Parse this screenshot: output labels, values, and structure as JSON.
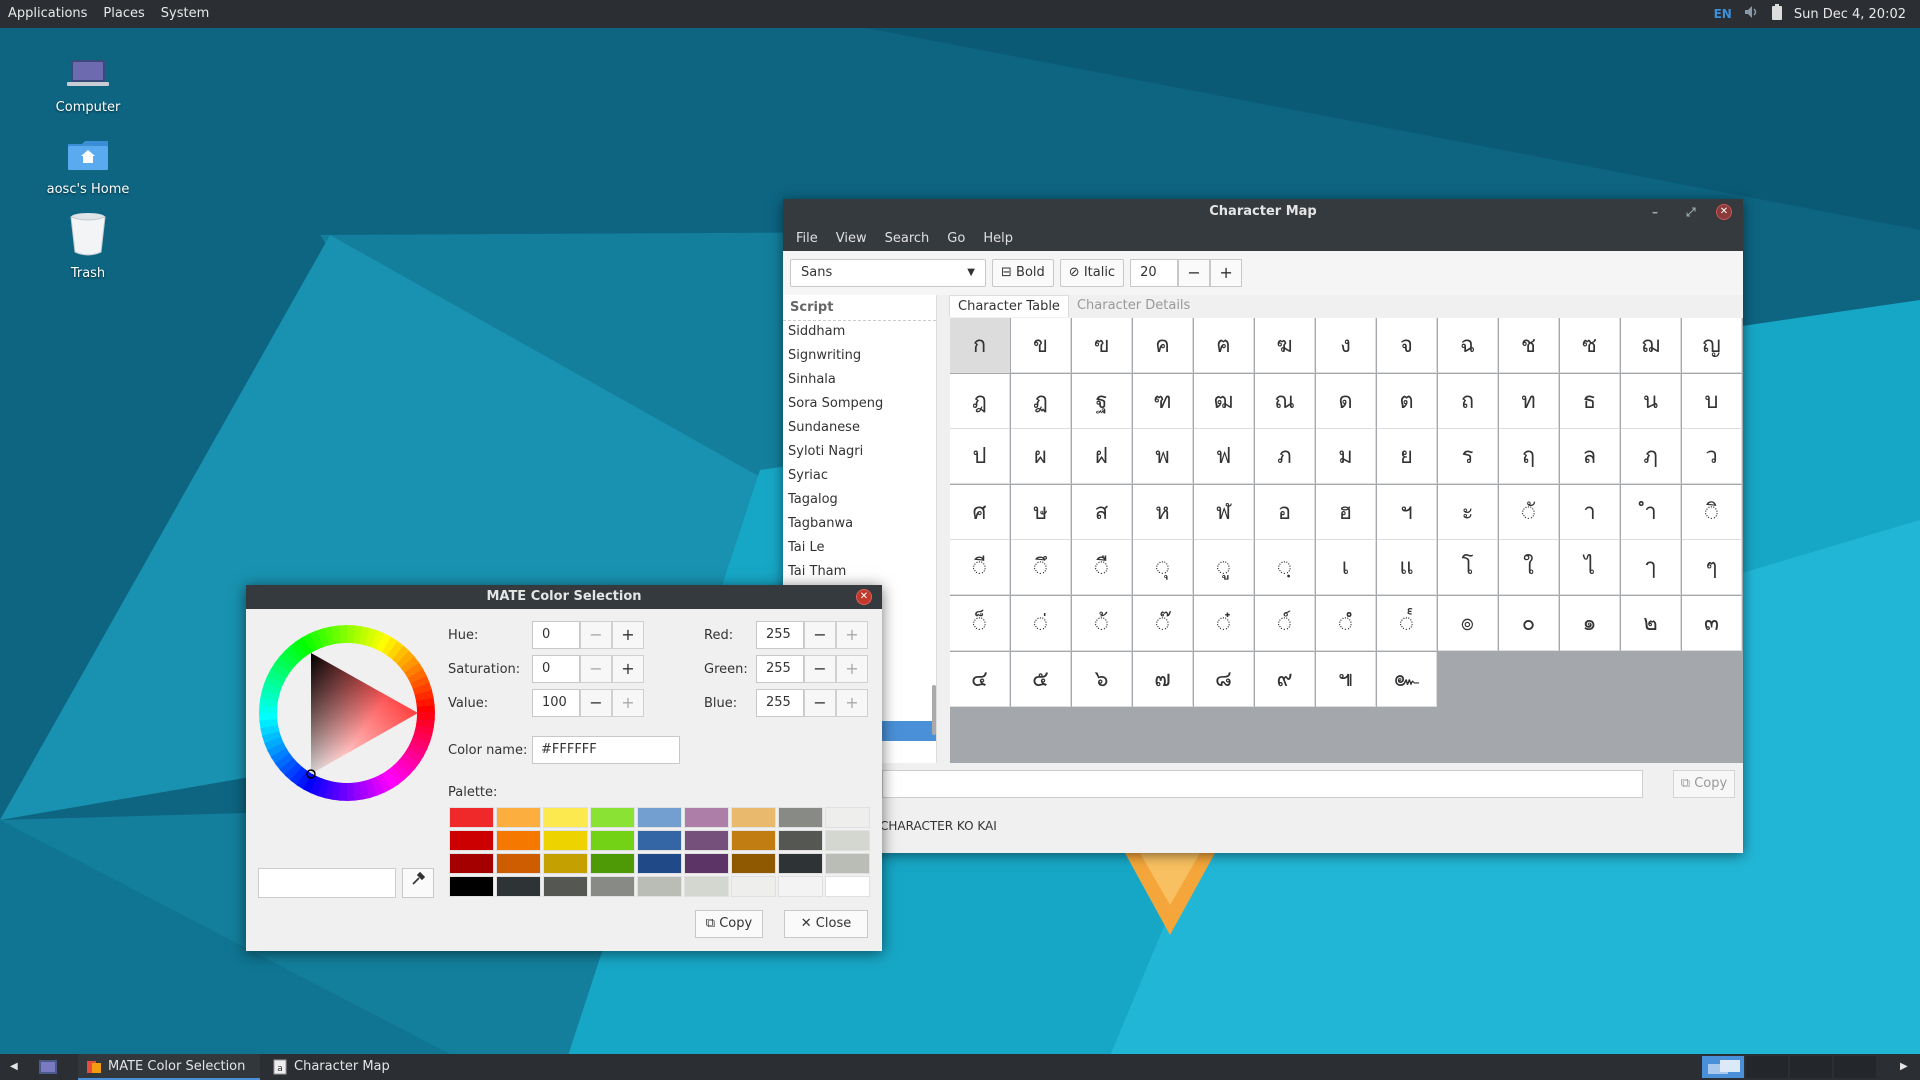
{
  "top_panel": {
    "menus": [
      "Applications",
      "Places",
      "System"
    ],
    "keyboard": "EN",
    "clock": "Sun Dec 4, 20:02"
  },
  "desktop": {
    "icons": [
      {
        "label": "Computer",
        "icon": "laptop-icon"
      },
      {
        "label": "aosc's Home",
        "icon": "home-folder-icon"
      },
      {
        "label": "Trash",
        "icon": "trash-icon"
      }
    ]
  },
  "charmap": {
    "title": "Character Map",
    "menu": [
      "File",
      "View",
      "Search",
      "Go",
      "Help"
    ],
    "font": "Sans",
    "bold_label": "Bold",
    "italic_label": "Italic",
    "size": "20",
    "script_header": "Script",
    "scripts": [
      "Siddham",
      "Signwriting",
      "Sinhala",
      "Sora Sompeng",
      "Sundanese",
      "Syloti Nagri",
      "Syriac",
      "Tagalog",
      "Tagbanwa",
      "Tai Le",
      "Tai Tham"
    ],
    "tabs": [
      "Character Table",
      "Character Details"
    ],
    "chars": [
      "ก",
      "ข",
      "ฃ",
      "ค",
      "ฅ",
      "ฆ",
      "ง",
      "จ",
      "ฉ",
      "ช",
      "ซ",
      "ฌ",
      "ญ",
      "ฎ",
      "ฏ",
      "ฐ",
      "ฑ",
      "ฒ",
      "ณ",
      "ด",
      "ต",
      "ถ",
      "ท",
      "ธ",
      "น",
      "บ",
      "ป",
      "ผ",
      "ฝ",
      "พ",
      "ฟ",
      "ภ",
      "ม",
      "ย",
      "ร",
      "ฤ",
      "ล",
      "ฦ",
      "ว",
      "ศ",
      "ษ",
      "ส",
      "ห",
      "ฬ",
      "อ",
      "ฮ",
      "ฯ",
      "ะ",
      "◌ั",
      "า",
      "ำ",
      "◌ิ",
      "◌ี",
      "◌ึ",
      "◌ื",
      "◌ุ",
      "◌ู",
      "◌ฺ",
      "เ",
      "แ",
      "โ",
      "ใ",
      "ไ",
      "ๅ",
      "ๆ",
      "◌็",
      "◌่",
      "◌้",
      "◌๊",
      "◌๋",
      "◌์",
      "◌ํ",
      "◌๎",
      "๏",
      "๐",
      "๑",
      "๒",
      "๓",
      "๔",
      "๕",
      "๖",
      "๗",
      "๘",
      "๙",
      "๚",
      "๛"
    ],
    "copy_label": "Copy",
    "status": "CHARACTER KO KAI"
  },
  "color_dialog": {
    "title": "MATE Color Selection",
    "hue_label": "Hue:",
    "hue": "0",
    "saturation_label": "Saturation:",
    "saturation": "0",
    "value_label": "Value:",
    "value": "100",
    "red_label": "Red:",
    "red": "255",
    "green_label": "Green:",
    "green": "255",
    "blue_label": "Blue:",
    "blue": "255",
    "color_name_label": "Color name:",
    "color_name": "#FFFFFF",
    "palette_label": "Palette:",
    "palette": [
      [
        "#ef2929",
        "#fcaf3e",
        "#fce94f",
        "#8ae234",
        "#729fcf",
        "#ad7fa8",
        "#e9b96e",
        "#888a85",
        "#eeeeec"
      ],
      [
        "#cc0000",
        "#f57900",
        "#edd400",
        "#73d216",
        "#3465a4",
        "#75507b",
        "#c17d11",
        "#555753",
        "#d3d7cf"
      ],
      [
        "#a40000",
        "#ce5c00",
        "#c4a000",
        "#4e9a06",
        "#204a87",
        "#5c3566",
        "#8f5902",
        "#2e3436",
        "#babdb6"
      ],
      [
        "#000000",
        "#2e3436",
        "#555753",
        "#888a85",
        "#babdb6",
        "#d3d7cf",
        "#eeeeec",
        "#f3f3f3",
        "#ffffff"
      ]
    ],
    "copy_label": "Copy",
    "close_label": "Close"
  },
  "taskbar": {
    "tasks": [
      "MATE Color Selection",
      "Character Map"
    ]
  }
}
